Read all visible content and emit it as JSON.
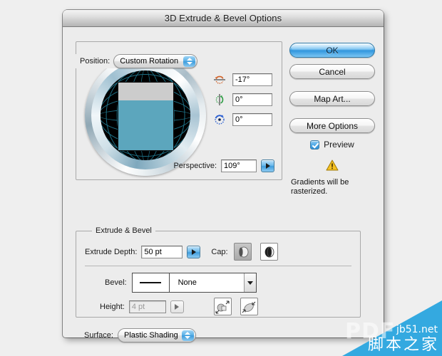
{
  "window": {
    "title": "3D Extrude & Bevel Options"
  },
  "position": {
    "legend_label": "Position:",
    "preset_value": "Custom Rotation",
    "rotations": [
      {
        "axis": "x",
        "icon": "rotate-x-axis-icon",
        "value": "-17°",
        "color": "#d2642a"
      },
      {
        "axis": "y",
        "icon": "rotate-y-axis-icon",
        "value": "0°",
        "color": "#2f9e46"
      },
      {
        "axis": "z",
        "icon": "rotate-z-axis-icon",
        "value": "0°",
        "color": "#2a5fd2"
      }
    ],
    "perspective_label": "Perspective:",
    "perspective_value": "109°"
  },
  "track_cube": {
    "sphere_color": "#000000",
    "grid_color": "#1d6f84",
    "face_color": "#5ca6bd",
    "face_top_color": "#cccccc",
    "ring_color": "#cfdde4"
  },
  "buttons": {
    "ok": "OK",
    "cancel": "Cancel",
    "map_art": "Map Art...",
    "more_options": "More Options"
  },
  "preview": {
    "label": "Preview",
    "checked": true,
    "warning_icon": "warning-triangle-icon",
    "warning_text": "Gradients will be rasterized."
  },
  "extrude": {
    "legend_label": "Extrude & Bevel",
    "depth_label": "Extrude Depth:",
    "depth_value": "50 pt",
    "cap_label": "Cap:",
    "cap_options": [
      {
        "name": "cap-solid-button",
        "selected": true
      },
      {
        "name": "cap-hollow-button",
        "selected": false
      }
    ],
    "bevel_label": "Bevel:",
    "bevel_value": "None",
    "height_label": "Height:",
    "height_value": "4 pt",
    "height_disabled": true,
    "bevel_direction_options": [
      {
        "name": "bevel-extent-out-button",
        "selected": false
      },
      {
        "name": "bevel-extent-in-button",
        "selected": false
      }
    ]
  },
  "surface": {
    "label": "Surface:",
    "value": "Plastic Shading"
  },
  "watermark": {
    "ghost": "PDF",
    "site": "jb51.net",
    "chinese": "脚本之家",
    "color": "#34a9e0"
  }
}
